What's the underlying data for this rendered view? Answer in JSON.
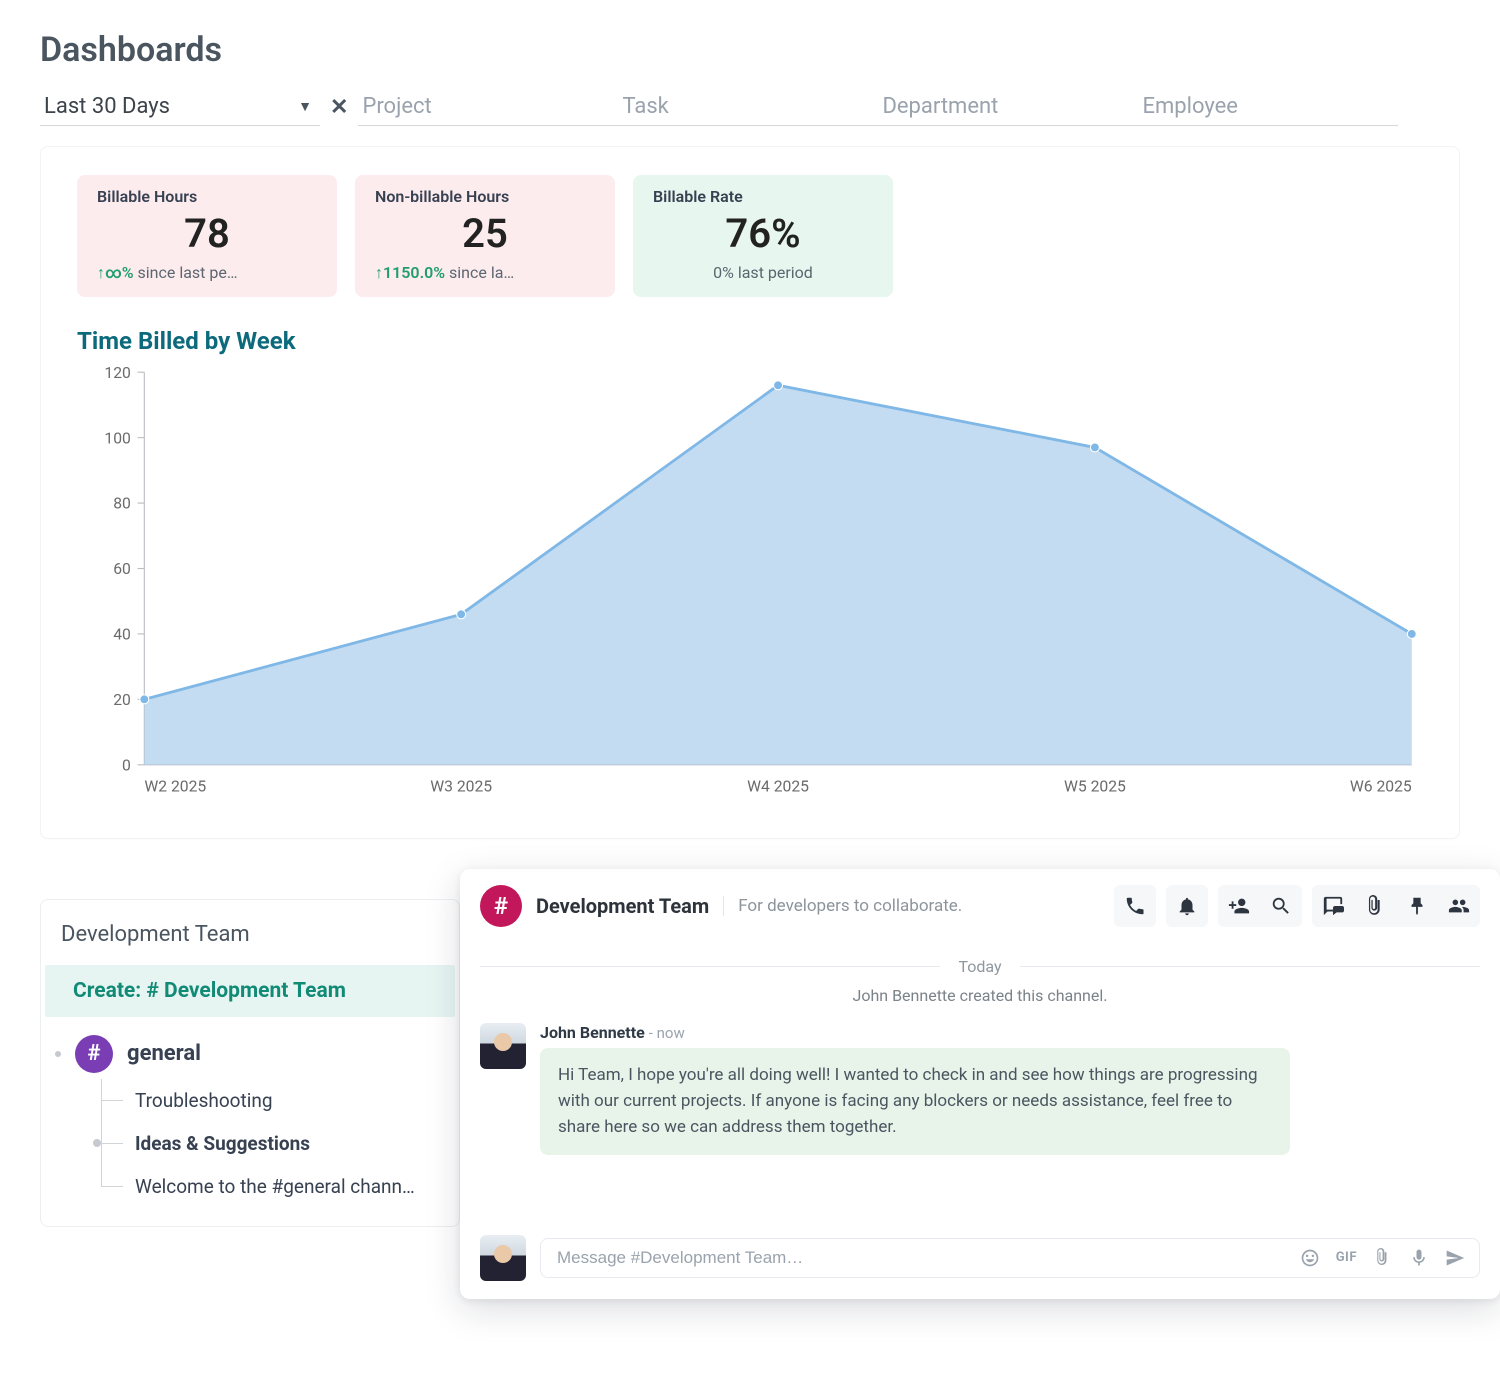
{
  "page_title": "Dashboards",
  "filters": {
    "timerange": "Last 30 Days",
    "project_placeholder": "Project",
    "task_placeholder": "Task",
    "department_placeholder": "Department",
    "employee_placeholder": "Employee"
  },
  "stats": {
    "billable": {
      "label": "Billable Hours",
      "value": "78",
      "delta": "↑∞%",
      "since": " since last pe…"
    },
    "nonbillable": {
      "label": "Non-billable Hours",
      "value": "25",
      "delta": "↑1150.0%",
      "since": " since la…"
    },
    "rate": {
      "label": "Billable Rate",
      "value": "76%",
      "foot": "0% last period"
    }
  },
  "chart_title": "Time Billed by Week",
  "chart_data": {
    "type": "area",
    "title": "Time Billed by Week",
    "xlabel": "",
    "ylabel": "",
    "ylim": [
      0,
      120
    ],
    "categories": [
      "W2 2025",
      "W3 2025",
      "W4 2025",
      "W5 2025",
      "W6 2025"
    ],
    "values": [
      20,
      46,
      116,
      97,
      40
    ],
    "color": "#7fb7e6",
    "fill": "#b4d3ee"
  },
  "sidebar": {
    "heading": "Development Team",
    "create_label": "Create: # Development Team",
    "general_label": "general",
    "items": [
      {
        "label": "Troubleshooting",
        "bold": false
      },
      {
        "label": "Ideas & Suggestions",
        "bold": true
      },
      {
        "label": "Welcome to the #general chann…",
        "bold": false
      }
    ]
  },
  "chat": {
    "channel_name": "Development Team",
    "channel_desc": "For developers to collaborate.",
    "divider_label": "Today",
    "system_message": "John Bennette created this channel.",
    "message": {
      "author": "John Bennette",
      "when": "- now",
      "text": "Hi Team, I hope you're all doing well! I wanted to check in and see how things are progressing with our current projects. If anyone is facing any blockers or needs assistance, feel free to share here so we can address them together."
    },
    "composer_placeholder": "Message #Development Team…",
    "gif_label": "GIF"
  }
}
